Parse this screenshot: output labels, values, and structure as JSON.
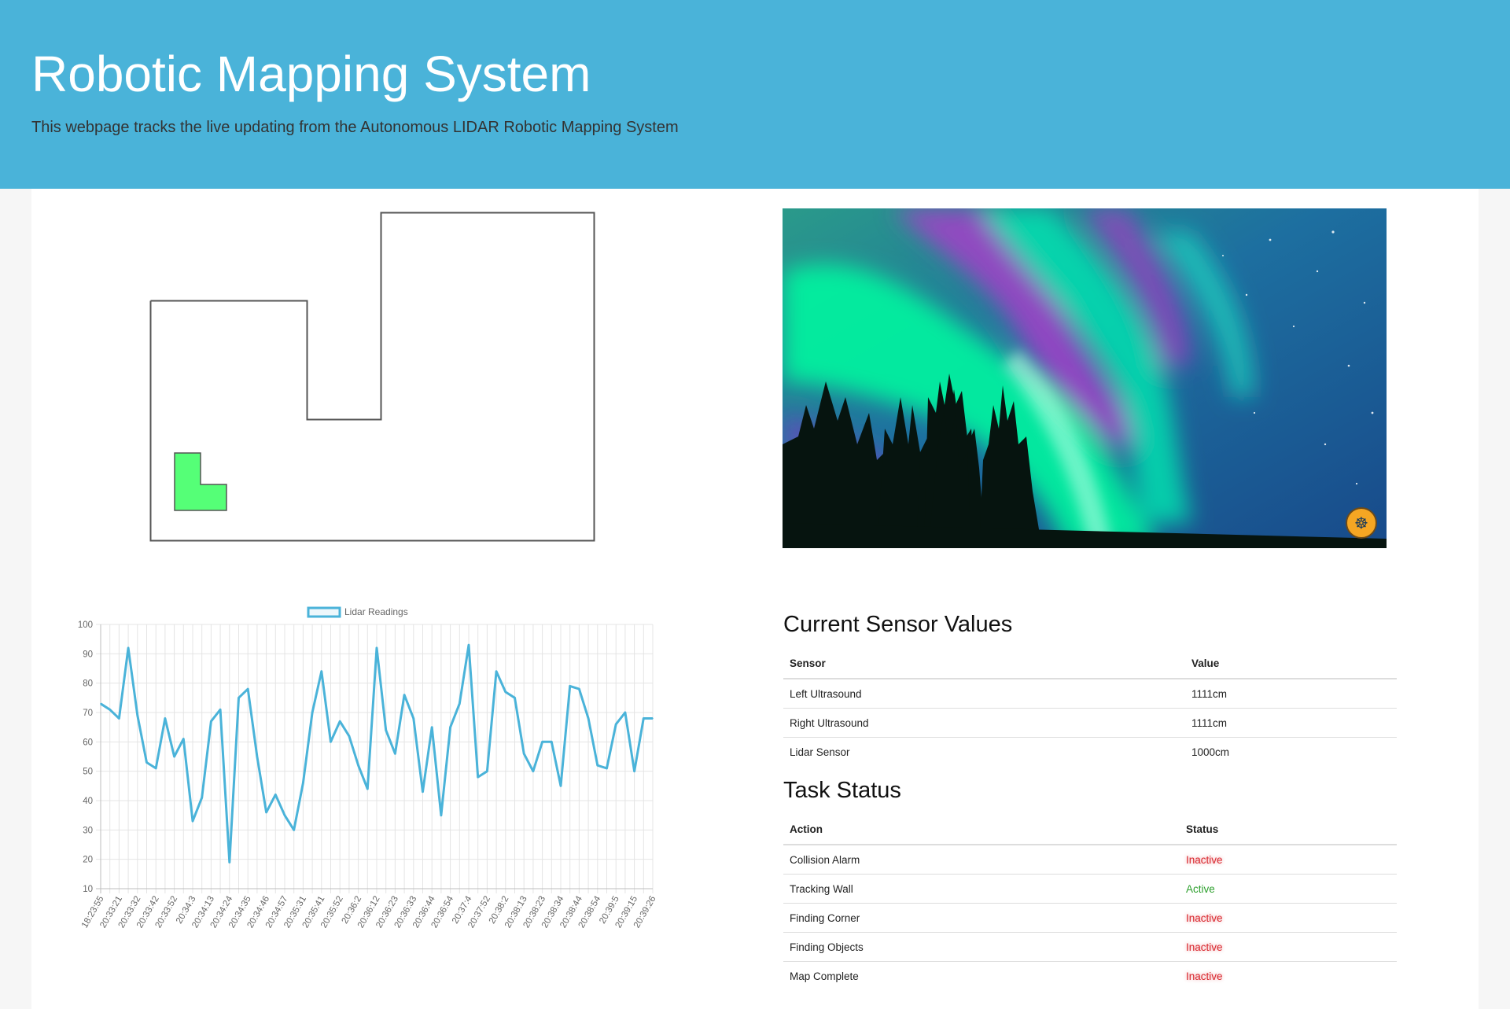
{
  "header": {
    "title": "Robotic Mapping System",
    "subtitle": "This webpage tracks the live updating from the Autonomous LIDAR Robotic Mapping System"
  },
  "map": {
    "robot_color": "#55ff77"
  },
  "video": {
    "icon": "meditation-logo-icon"
  },
  "sensors": {
    "title": "Current Sensor Values",
    "headers": [
      "Sensor",
      "Value"
    ],
    "rows": [
      {
        "sensor": "Left Ultrasound",
        "value": "1111cm"
      },
      {
        "sensor": "Right Ultrasound",
        "value": "1111cm"
      },
      {
        "sensor": "Lidar Sensor",
        "value": "1000cm"
      }
    ]
  },
  "tasks": {
    "title": "Task Status",
    "headers": [
      "Action",
      "Status"
    ],
    "rows": [
      {
        "action": "Collision Alarm",
        "status": "Inactive"
      },
      {
        "action": "Tracking Wall",
        "status": "Active"
      },
      {
        "action": "Finding Corner",
        "status": "Inactive"
      },
      {
        "action": "Finding Objects",
        "status": "Inactive"
      },
      {
        "action": "Map Complete",
        "status": "Inactive"
      }
    ],
    "status_colors": {
      "Inactive": "#d9282f",
      "Active": "#2ea02e"
    }
  },
  "chart_data": {
    "type": "line",
    "series": [
      {
        "name": "Lidar Readings",
        "color": "#4ab3d9",
        "values": [
          73,
          71,
          68,
          92,
          69,
          53,
          51,
          68,
          55,
          61,
          33,
          41,
          67,
          71,
          19,
          75,
          78,
          55,
          36,
          42,
          35,
          30,
          46,
          70,
          84,
          60,
          67,
          62,
          52,
          44,
          92,
          64,
          56,
          76,
          68,
          43,
          65,
          35,
          65,
          73,
          93,
          48,
          50,
          84,
          77,
          75,
          56,
          50,
          60,
          60,
          45,
          79,
          78,
          68,
          52,
          51,
          66,
          70,
          50,
          68,
          68
        ]
      }
    ],
    "xtick_labels": [
      "18:23:55",
      "20:33:21",
      "20:33:32",
      "20:33:42",
      "20:33:52",
      "20:34:3",
      "20:34:13",
      "20:34:24",
      "20:34:35",
      "20:34:46",
      "20:34:57",
      "20:35:31",
      "20:35:41",
      "20:35:52",
      "20:36:2",
      "20:36:12",
      "20:36:23",
      "20:36:33",
      "20:36:44",
      "20:36:54",
      "20:37:4",
      "20:37:52",
      "20:38:2",
      "20:38:13",
      "20:38:23",
      "20:38:34",
      "20:38:44",
      "20:38:54",
      "20:39:5",
      "20:39:15",
      "20:39:26"
    ],
    "yticks": [
      10,
      20,
      30,
      40,
      50,
      60,
      70,
      80,
      90,
      100
    ],
    "ylim": [
      10,
      100
    ],
    "legend_position": "top",
    "grid": true
  }
}
